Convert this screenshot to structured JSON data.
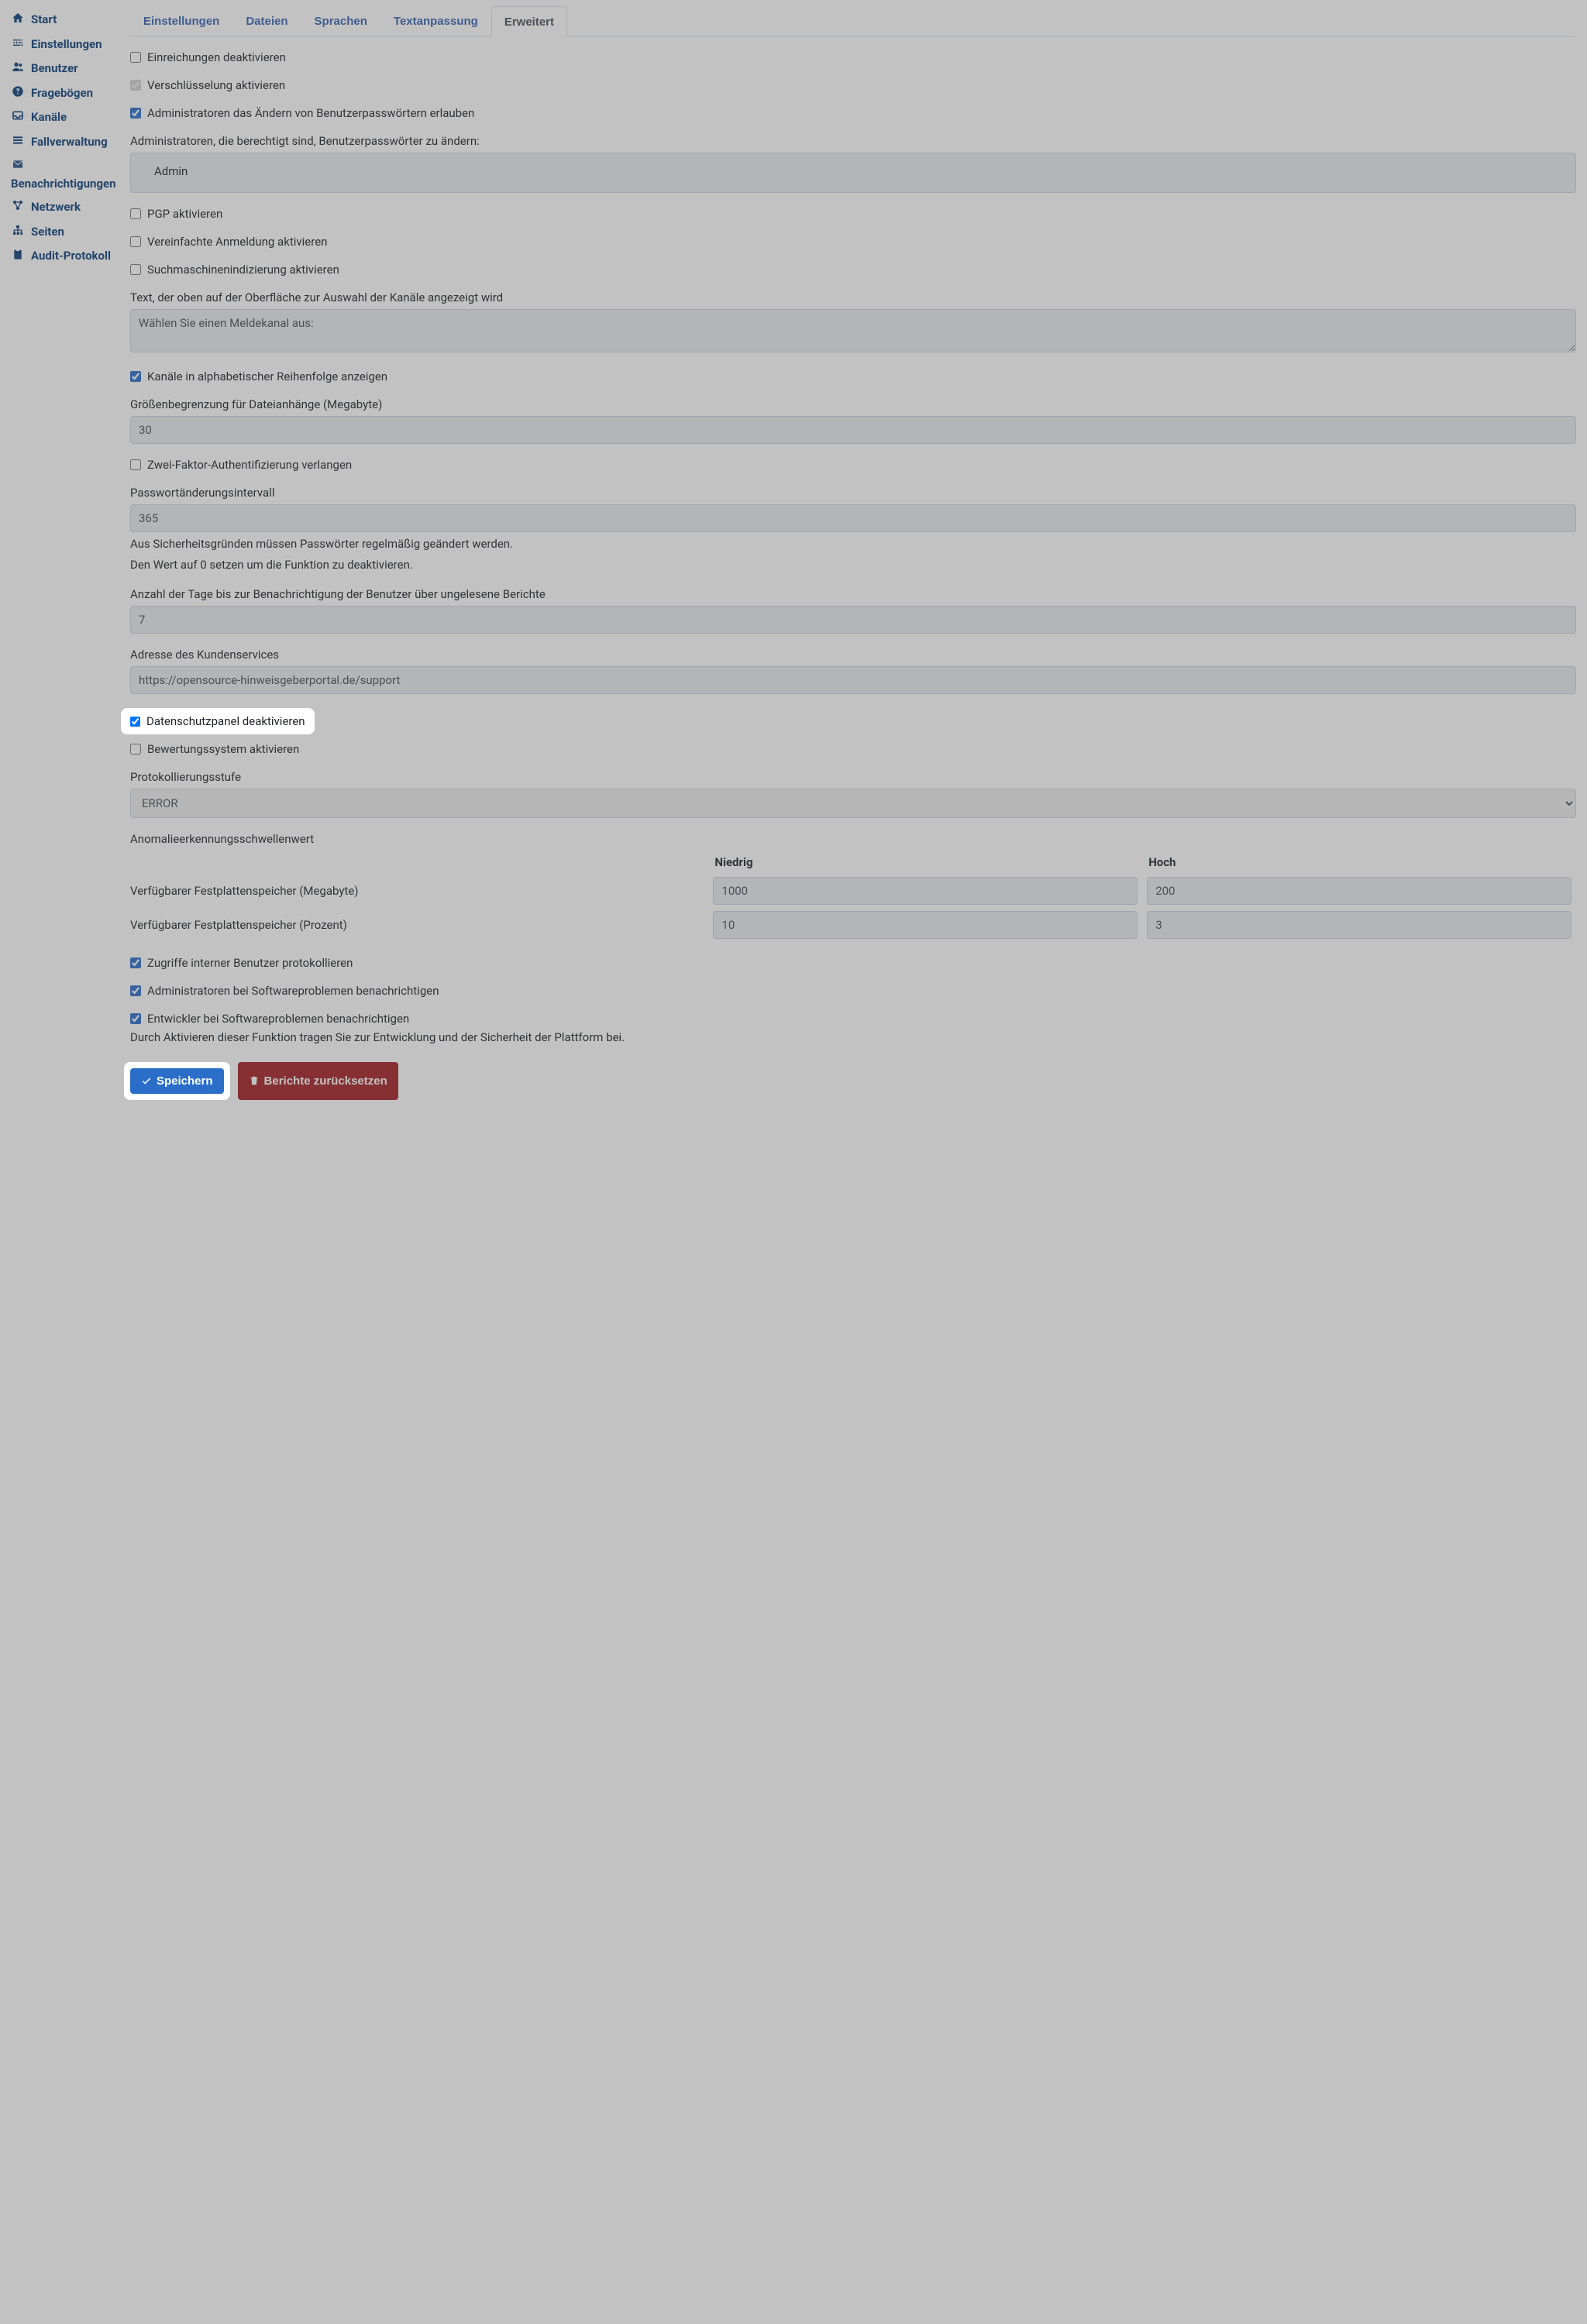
{
  "sidebar": {
    "items": [
      {
        "label": "Start",
        "icon": "home"
      },
      {
        "label": "Einstellungen",
        "icon": "cog"
      },
      {
        "label": "Benutzer",
        "icon": "users"
      },
      {
        "label": "Fragebögen",
        "icon": "question"
      },
      {
        "label": "Kanäle",
        "icon": "inbox"
      },
      {
        "label": "Fallverwaltung",
        "icon": "bars"
      },
      {
        "label": "Benachrichtigungen",
        "icon": "envelope"
      },
      {
        "label": "Netzwerk",
        "icon": "network"
      },
      {
        "label": "Seiten",
        "icon": "sitemap"
      },
      {
        "label": "Audit-Protokoll",
        "icon": "clipboard"
      }
    ]
  },
  "tabs": [
    {
      "label": "Einstellungen"
    },
    {
      "label": "Dateien"
    },
    {
      "label": "Sprachen"
    },
    {
      "label": "Textanpassung"
    },
    {
      "label": "Erweitert",
      "active": true
    }
  ],
  "fields": {
    "disable_submissions": "Einreichungen deaktivieren",
    "enable_encryption": "Verschlüsselung aktivieren",
    "allow_admin_pw": "Administratoren das Ändern von Benutzerpasswörtern erlauben",
    "authorized_admins_label": "Administratoren, die berechtigt sind, Benutzerpasswörter zu ändern:",
    "authorized_admins_value": "Admin",
    "enable_pgp": "PGP aktivieren",
    "enable_simple_login": "Vereinfachte Anmeldung aktivieren",
    "enable_seo": "Suchmaschinenindizierung aktivieren",
    "channel_text_label": "Text, der oben auf der Oberfläche zur Auswahl der Kanäle angezeigt wird",
    "channel_text_value": "Wählen Sie einen Meldekanal aus:",
    "channels_alpha": "Kanäle in alphabetischer Reihenfolge anzeigen",
    "attachment_limit_label": "Größenbegrenzung für Dateianhänge (Megabyte)",
    "attachment_limit_value": "30",
    "require_2fa": "Zwei-Faktor-Authentifizierung verlangen",
    "pw_interval_label": "Passwortänderungsintervall",
    "pw_interval_value": "365",
    "pw_interval_help1": "Aus Sicherheitsgründen müssen Passwörter regelmäßig geändert werden.",
    "pw_interval_help2": "Den Wert auf 0 setzen um die Funktion zu deaktivieren.",
    "unread_days_label": "Anzahl der Tage bis zur Benachrichtigung der Benutzer über ungelesene Berichte",
    "unread_days_value": "7",
    "support_label": "Adresse des Kundenservices",
    "support_value": "https://opensource-hinweisgeberportal.de/support",
    "disable_privacy_panel": "Datenschutzpanel deaktivieren",
    "enable_rating": "Bewertungssystem aktivieren",
    "log_level_label": "Protokollierungsstufe",
    "log_level_value": "ERROR",
    "anomaly_label": "Anomalieerkennungsschwellenwert",
    "anomaly_low": "Niedrig",
    "anomaly_high": "Hoch",
    "disk_mb_label": "Verfügbarer Festplattenspeicher (Megabyte)",
    "disk_mb_low": "1000",
    "disk_mb_high": "200",
    "disk_pct_label": "Verfügbarer Festplattenspeicher (Prozent)",
    "disk_pct_low": "10",
    "disk_pct_high": "3",
    "log_internal": "Zugriffe interner Benutzer protokollieren",
    "notify_admin_sw": "Administratoren bei Softwareproblemen benachrichtigen",
    "notify_dev_sw": "Entwickler bei Softwareproblemen benachrichtigen",
    "notify_dev_help": "Durch Aktivieren dieser Funktion tragen Sie zur Entwicklung und der Sicherheit der Plattform bei.",
    "save_btn": "Speichern",
    "reset_btn": "Berichte zurücksetzen"
  }
}
